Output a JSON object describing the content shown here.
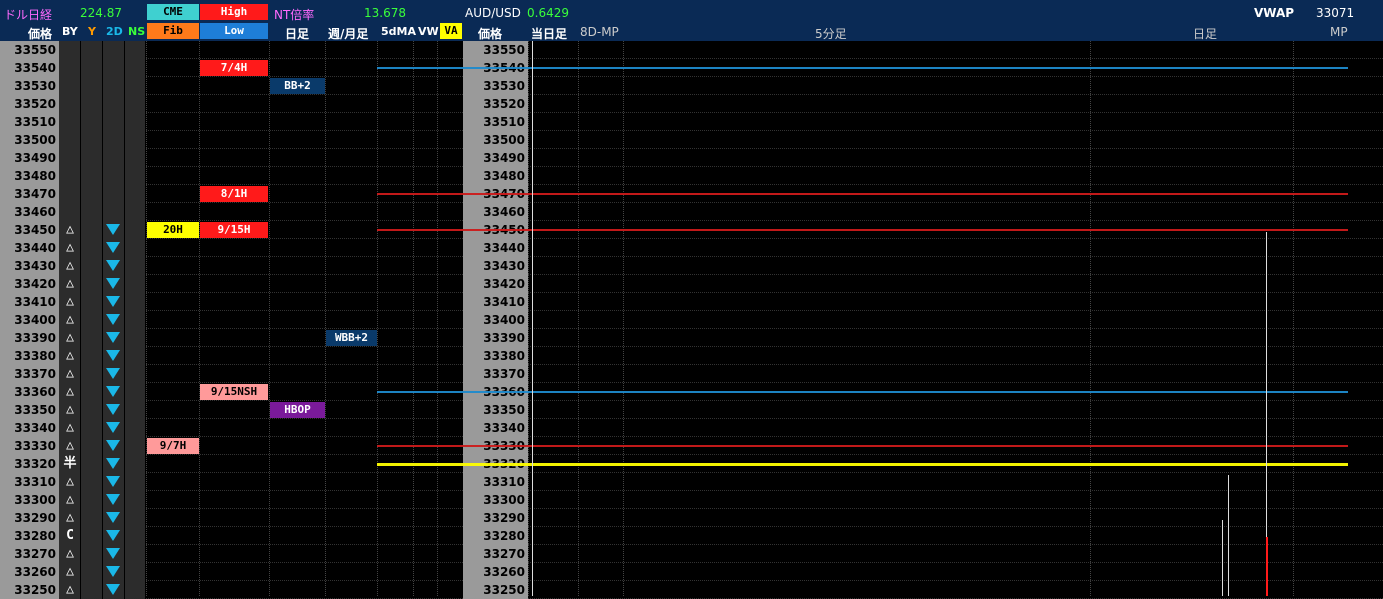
{
  "header": {
    "row1": [
      {
        "text": "ドル日経",
        "color": "#ff6aff"
      },
      {
        "text": "224.87",
        "color": "#3aff3a"
      },
      {
        "text": "CME",
        "color": "#000000"
      },
      {
        "text": "High",
        "color": "#ffffff"
      },
      {
        "text": "NT倍率",
        "color": "#ff6aff"
      },
      {
        "text": "13.678",
        "color": "#3aff3a"
      },
      {
        "text": "AUD/USD",
        "color": "#ffffff"
      },
      {
        "text": "0.6429",
        "color": "#3aff3a"
      },
      {
        "text": "VWAP",
        "color": "#ffffff"
      },
      {
        "text": "33071",
        "color": "#ffffff"
      }
    ],
    "row2": {
      "price_label": "価格",
      "by": "BY",
      "y": "Y",
      "two_d": "2D",
      "ns": "NS",
      "fib": "Fib",
      "low": "Low",
      "daily": "日足",
      "weekly_monthly": "週/月足",
      "ma5": "5dMA",
      "vw": "VW",
      "va": "VA",
      "price_label2": "価格",
      "today": "当日足",
      "mp8d": "8D-MP",
      "min5": "5分足",
      "daily2": "日足",
      "mp": "MP"
    }
  },
  "colors": {
    "red": "#ff1a1a",
    "blue": "#1e8acc",
    "yellow": "#ffff00",
    "pink": "#ff9a9a",
    "purple": "#7a1a9a",
    "navy": "#0a3a6a",
    "cyan": "#1ab8e8"
  },
  "rows": [
    {
      "price": "33550",
      "by": "",
      "tri": false,
      "fib": "",
      "hl": "",
      "hl_color": "",
      "daily": "",
      "weekly": "",
      "line": ""
    },
    {
      "price": "33540",
      "by": "",
      "tri": false,
      "fib": "",
      "hl": "7/4H",
      "hl_color": "red",
      "daily": "",
      "weekly": "",
      "line": "blue"
    },
    {
      "price": "33530",
      "by": "",
      "tri": false,
      "fib": "",
      "hl": "",
      "hl_color": "",
      "daily": "BB+2",
      "weekly": "",
      "line": ""
    },
    {
      "price": "33520",
      "by": "",
      "tri": false,
      "fib": "",
      "hl": "",
      "hl_color": "",
      "daily": "",
      "weekly": "",
      "line": ""
    },
    {
      "price": "33510",
      "by": "",
      "tri": false,
      "fib": "",
      "hl": "",
      "hl_color": "",
      "daily": "",
      "weekly": "",
      "line": ""
    },
    {
      "price": "33500",
      "by": "",
      "tri": false,
      "fib": "",
      "hl": "",
      "hl_color": "",
      "daily": "",
      "weekly": "",
      "line": ""
    },
    {
      "price": "33490",
      "by": "",
      "tri": false,
      "fib": "",
      "hl": "",
      "hl_color": "",
      "daily": "",
      "weekly": "",
      "line": ""
    },
    {
      "price": "33480",
      "by": "",
      "tri": false,
      "fib": "",
      "hl": "",
      "hl_color": "",
      "daily": "",
      "weekly": "",
      "line": ""
    },
    {
      "price": "33470",
      "by": "",
      "tri": false,
      "fib": "",
      "hl": "8/1H",
      "hl_color": "red",
      "daily": "",
      "weekly": "",
      "line": "red"
    },
    {
      "price": "33460",
      "by": "",
      "tri": false,
      "fib": "",
      "hl": "",
      "hl_color": "",
      "daily": "",
      "weekly": "",
      "line": ""
    },
    {
      "price": "33450",
      "by": "△",
      "tri": true,
      "fib": "20H",
      "hl": "9/15H",
      "hl_color": "red",
      "daily": "",
      "weekly": "",
      "line": "red"
    },
    {
      "price": "33440",
      "by": "△",
      "tri": true,
      "fib": "",
      "hl": "",
      "hl_color": "",
      "daily": "",
      "weekly": "",
      "line": ""
    },
    {
      "price": "33430",
      "by": "△",
      "tri": true,
      "fib": "",
      "hl": "",
      "hl_color": "",
      "daily": "",
      "weekly": "",
      "line": ""
    },
    {
      "price": "33420",
      "by": "△",
      "tri": true,
      "fib": "",
      "hl": "",
      "hl_color": "",
      "daily": "",
      "weekly": "",
      "line": ""
    },
    {
      "price": "33410",
      "by": "△",
      "tri": true,
      "fib": "",
      "hl": "",
      "hl_color": "",
      "daily": "",
      "weekly": "",
      "line": ""
    },
    {
      "price": "33400",
      "by": "△",
      "tri": true,
      "fib": "",
      "hl": "",
      "hl_color": "",
      "daily": "",
      "weekly": "",
      "line": ""
    },
    {
      "price": "33390",
      "by": "△",
      "tri": true,
      "fib": "",
      "hl": "",
      "hl_color": "",
      "daily": "",
      "weekly": "WBB+2",
      "line": ""
    },
    {
      "price": "33380",
      "by": "△",
      "tri": true,
      "fib": "",
      "hl": "",
      "hl_color": "",
      "daily": "",
      "weekly": "",
      "line": ""
    },
    {
      "price": "33370",
      "by": "△",
      "tri": true,
      "fib": "",
      "hl": "",
      "hl_color": "",
      "daily": "",
      "weekly": "",
      "line": ""
    },
    {
      "price": "33360",
      "by": "△",
      "tri": true,
      "fib": "",
      "hl": "9/15NSH",
      "hl_color": "pink",
      "daily": "",
      "weekly": "",
      "line": "blue"
    },
    {
      "price": "33350",
      "by": "△",
      "tri": true,
      "fib": "",
      "hl": "",
      "hl_color": "",
      "daily": "HBOP",
      "weekly": "",
      "line": ""
    },
    {
      "price": "33340",
      "by": "△",
      "tri": true,
      "fib": "",
      "hl": "",
      "hl_color": "",
      "daily": "",
      "weekly": "",
      "line": ""
    },
    {
      "price": "33330",
      "by": "△",
      "tri": true,
      "fib": "9/7H",
      "hl": "",
      "hl_color": "",
      "daily": "",
      "weekly": "",
      "line": "red"
    },
    {
      "price": "33320",
      "by": "半",
      "tri": true,
      "fib": "",
      "hl": "",
      "hl_color": "",
      "daily": "",
      "weekly": "",
      "line": "yellow"
    },
    {
      "price": "33310",
      "by": "△",
      "tri": true,
      "fib": "",
      "hl": "",
      "hl_color": "",
      "daily": "",
      "weekly": "",
      "line": ""
    },
    {
      "price": "33300",
      "by": "△",
      "tri": true,
      "fib": "",
      "hl": "",
      "hl_color": "",
      "daily": "",
      "weekly": "",
      "line": ""
    },
    {
      "price": "33290",
      "by": "△",
      "tri": true,
      "fib": "",
      "hl": "",
      "hl_color": "",
      "daily": "",
      "weekly": "",
      "line": ""
    },
    {
      "price": "33280",
      "by": "C",
      "tri": true,
      "fib": "",
      "hl": "",
      "hl_color": "",
      "daily": "",
      "weekly": "",
      "line": ""
    },
    {
      "price": "33270",
      "by": "△",
      "tri": true,
      "fib": "",
      "hl": "",
      "hl_color": "",
      "daily": "",
      "weekly": "",
      "line": ""
    },
    {
      "price": "33260",
      "by": "△",
      "tri": true,
      "fib": "",
      "hl": "",
      "hl_color": "",
      "daily": "",
      "weekly": "",
      "line": ""
    },
    {
      "price": "33250",
      "by": "△",
      "tri": true,
      "fib": "",
      "hl": "",
      "hl_color": "",
      "daily": "",
      "weekly": "",
      "line": ""
    }
  ]
}
